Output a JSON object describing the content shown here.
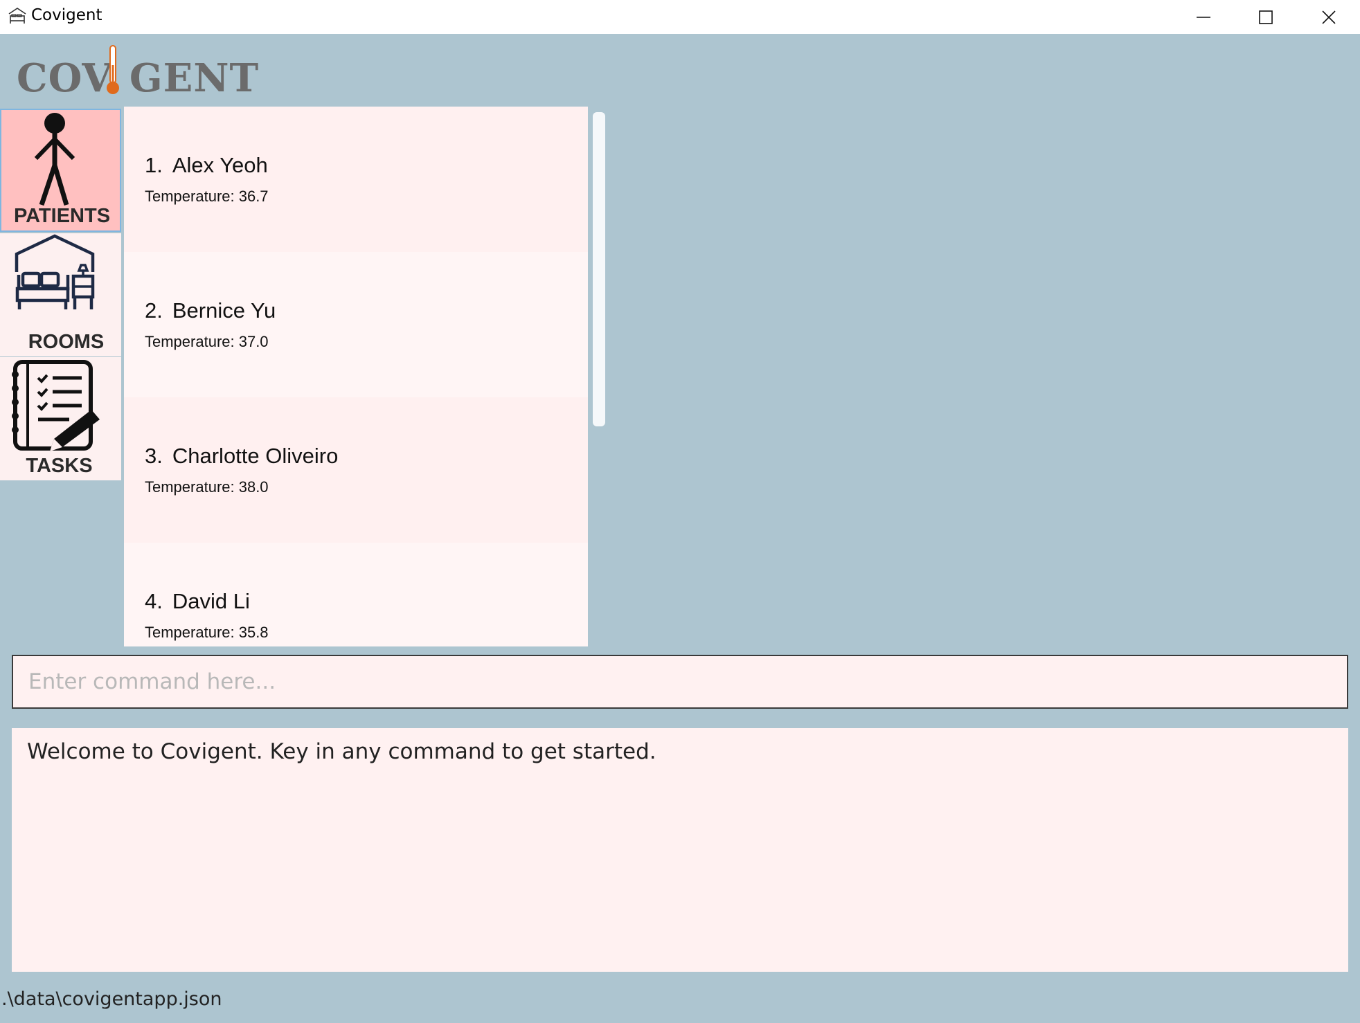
{
  "window": {
    "title": "Covigent",
    "controls": {
      "minimize": "minimize-icon",
      "maximize": "maximize-icon",
      "close": "close-icon"
    }
  },
  "logo": {
    "left": "COV",
    "right": "GENT",
    "thermometer_color": "#e06a1c"
  },
  "nav": {
    "items": [
      {
        "label": "PATIENTS",
        "icon": "person-icon",
        "active": true
      },
      {
        "label": "ROOMS",
        "icon": "bed-icon",
        "active": false
      },
      {
        "label": "TASKS",
        "icon": "checklist-icon",
        "active": false
      }
    ],
    "active_color": "#ffc0c0"
  },
  "patients": [
    {
      "index": "1.",
      "name": "Alex Yeoh",
      "temperature": "Temperature: 36.7"
    },
    {
      "index": "2.",
      "name": "Bernice Yu",
      "temperature": "Temperature: 37.0"
    },
    {
      "index": "3.",
      "name": "Charlotte Oliveiro",
      "temperature": "Temperature: 38.0"
    },
    {
      "index": "4.",
      "name": "David Li",
      "temperature": "Temperature: 35.8"
    }
  ],
  "command": {
    "placeholder": "Enter command here...",
    "value": ""
  },
  "result": {
    "text": "Welcome to Covigent. Key in any command to get started."
  },
  "status": {
    "path": ".\\data\\covigentapp.json"
  },
  "colors": {
    "background": "#adc5d0",
    "panel": "#fff1f1"
  }
}
